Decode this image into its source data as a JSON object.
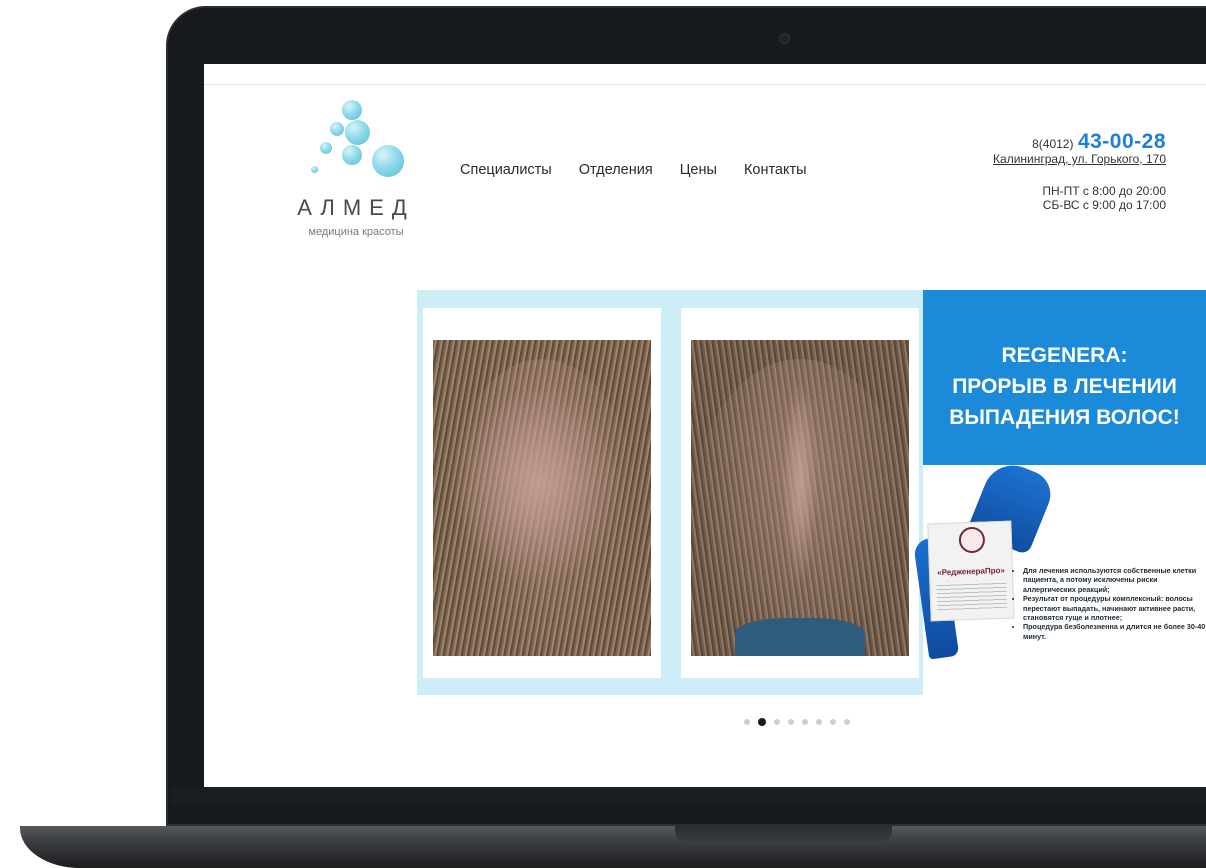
{
  "logo": {
    "wordmark": "АЛМЕД",
    "tagline": "медицина красоты"
  },
  "nav": {
    "items": [
      {
        "label": "Специалисты"
      },
      {
        "label": "Отделения"
      },
      {
        "label": "Цены"
      },
      {
        "label": "Контакты"
      }
    ]
  },
  "contacts": {
    "phone_code": "8(4012)",
    "phone_number": "43-00-28",
    "address": "Калининград, ул. Горького, 170",
    "hours_weekdays": "ПН-ПТ с 8:00 до 20:00",
    "hours_weekend": "СБ-ВС с 9:00 до 17:00"
  },
  "slider": {
    "promo_title_line1": "REGENERA:",
    "promo_title_line2": "ПРОРЫВ В ЛЕЧЕНИИ",
    "promo_title_line3": "ВЫПАДЕНИЯ ВОЛОС!",
    "product_label": "«РедженераПро»",
    "bullets": [
      "Для лечения используются собственные клетки пациента, а потому исключены риски аллергических реакций;",
      "Результат от процедуры комплексный: волосы перестают выпадать, начинают активнее расти, становятся гуще и плотнее;",
      "Процедура безболезненна и длится не более 30-40 минут."
    ],
    "slide_count": 8,
    "active_slide_index": 1
  },
  "colors": {
    "accent": "#1e7fd8",
    "promo_blue": "#1a8ad9",
    "slider_bg": "#cdeef6",
    "bubble": "#52bfd8"
  }
}
